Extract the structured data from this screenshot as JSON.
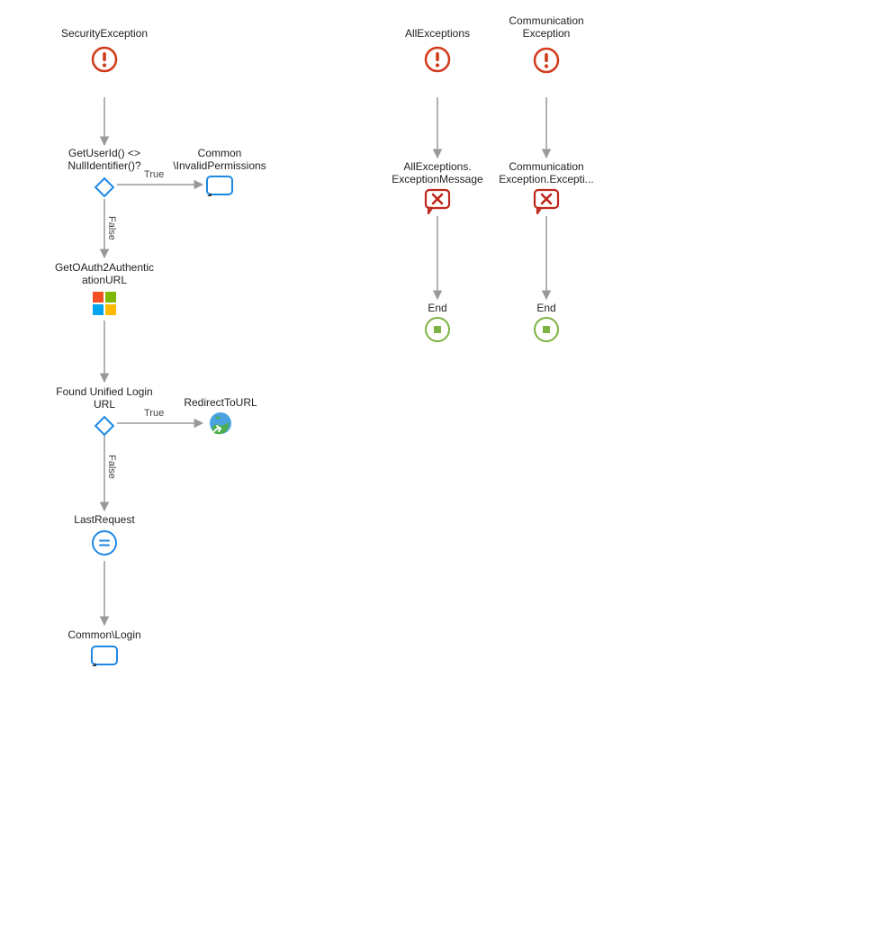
{
  "nodes": {
    "securityException": {
      "label": "SecurityException"
    },
    "getUserId": {
      "label": "GetUserId() <>\nNullIdentifier()?"
    },
    "invalidPermissions": {
      "label": "Common\n\\InvalidPermissions"
    },
    "getOAuthUrl": {
      "label": "GetOAuth2Authentic\nationURL"
    },
    "foundUnifiedLogin": {
      "label": "Found Unified Login\nURL"
    },
    "redirectToUrl": {
      "label": "RedirectToURL"
    },
    "lastRequest": {
      "label": "LastRequest"
    },
    "commonLogin": {
      "label": "Common\\Login"
    },
    "allExceptions": {
      "label": "AllExceptions"
    },
    "allExceptionsMsg": {
      "label": "AllExceptions.\nExceptionMessage"
    },
    "commException": {
      "label": "Communication\nException"
    },
    "commExceptionMsg": {
      "label": "Communication\nException.Excepti..."
    },
    "end1": {
      "label": "End"
    },
    "end2": {
      "label": "End"
    }
  },
  "edges": {
    "true1": "True",
    "false1": "False",
    "true2": "True",
    "false2": "False"
  }
}
